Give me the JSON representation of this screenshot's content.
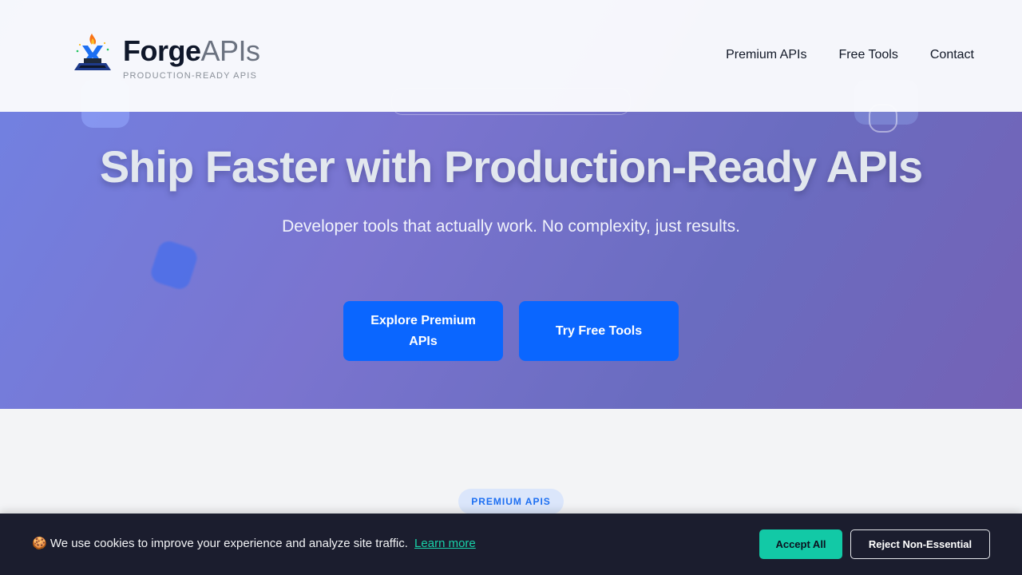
{
  "brand": {
    "name_bold": "Forge",
    "name_light": "APIs",
    "tagline": "PRODUCTION-READY APIS",
    "logo_icon": "anvil-flame-icon"
  },
  "nav": {
    "items": [
      {
        "label": "Premium APIs"
      },
      {
        "label": "Free Tools"
      },
      {
        "label": "Contact"
      }
    ]
  },
  "hero": {
    "title": "Ship Faster with Production-Ready APIs",
    "subtitle": "Developer tools that actually work. No complexity, just results.",
    "primary_button": "Explore Premium APIs",
    "secondary_button": "Try Free Tools"
  },
  "section": {
    "badge": "PREMIUM APIS"
  },
  "cookie_banner": {
    "emoji": "🍪",
    "message": "We use cookies to improve your experience and analyze site traffic.",
    "learn_more": "Learn more",
    "accept_label": "Accept All",
    "reject_label": "Reject Non-Essential"
  },
  "colors": {
    "accent": "#0a66ff",
    "cookie_accept": "#12c9a6",
    "cookie_bg": "#1b1d2e",
    "hero_gradient_start": "#7182e3",
    "hero_gradient_end": "#7462b6"
  }
}
